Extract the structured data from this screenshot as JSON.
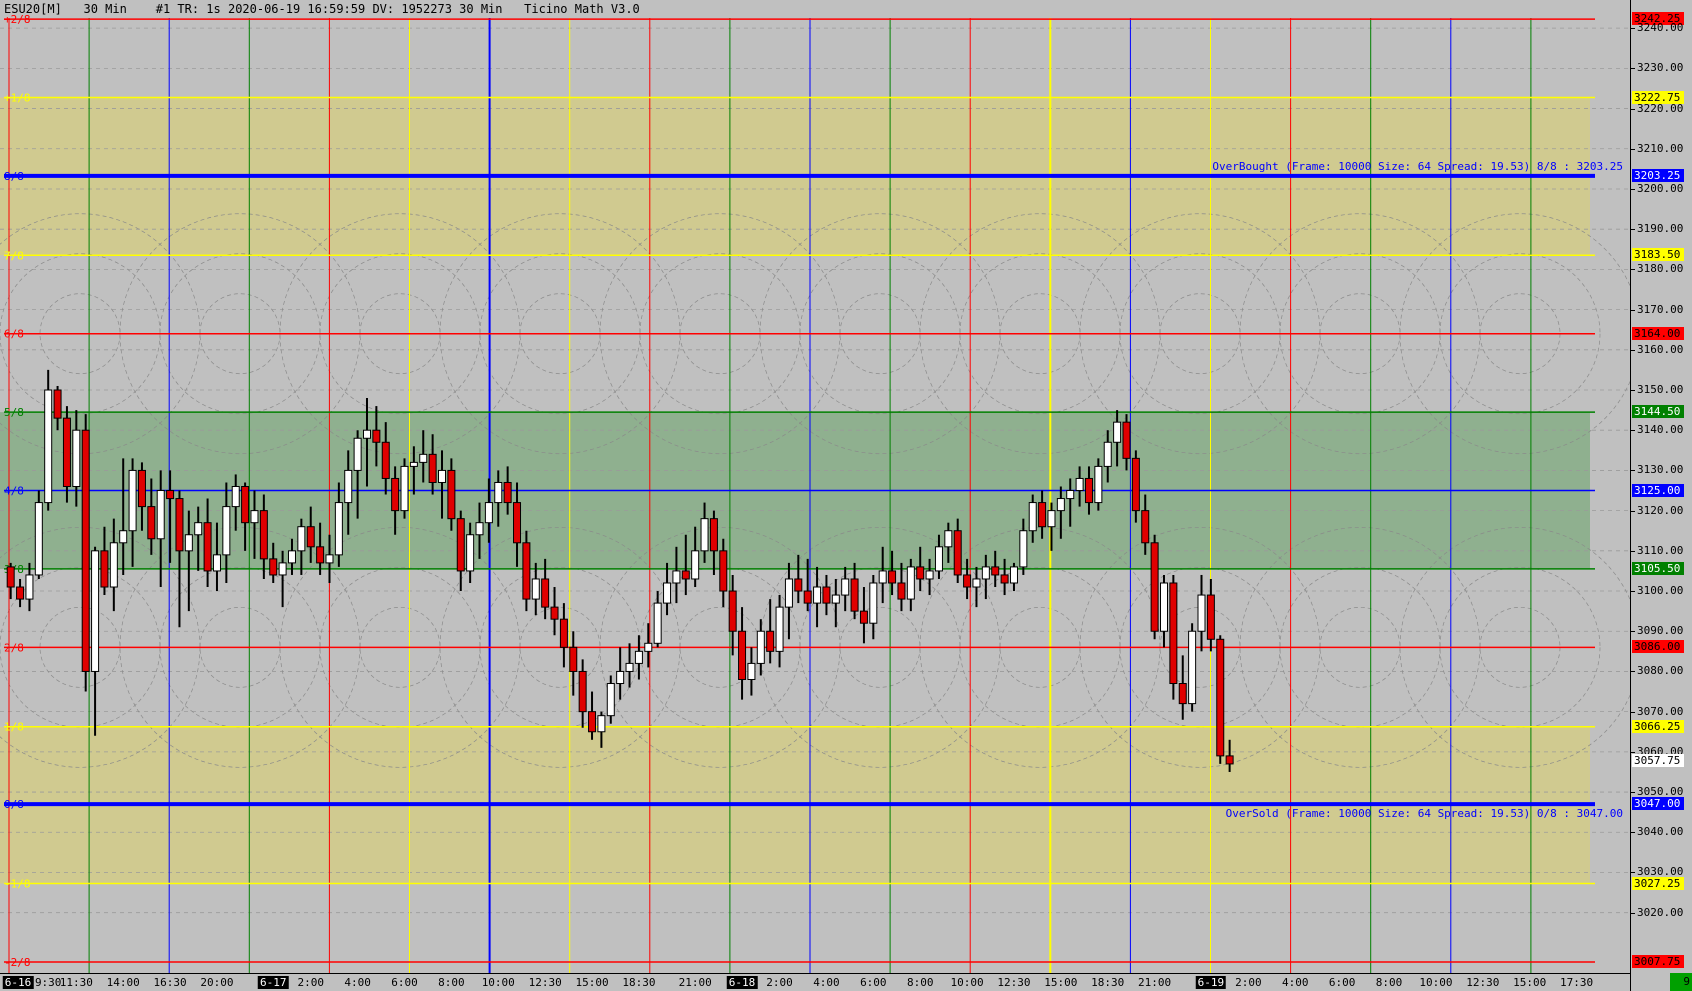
{
  "header": {
    "title": "ESU20[M]   30 Min    #1 TR: 1s 2020-06-19 16:59:59 DV: 1952273 30 Min   Ticino Math V3.0"
  },
  "colors": {
    "background": "#c0c0c0",
    "band_yellow": "#d0ca90",
    "band_green": "#8fb08f",
    "red": "#ff0000",
    "yellow": "#ffff00",
    "blue": "#0000ff",
    "green": "#008000",
    "candle_up": "#ffffff",
    "candle_down": "#e00000"
  },
  "chart_data": {
    "type": "candlestick",
    "symbol": "ESU20[M]",
    "timeframe": "30 Min",
    "ylim": [
      3005,
      3247
    ],
    "y_ticks": [
      3020,
      3030,
      3040,
      3050,
      3060,
      3070,
      3080,
      3090,
      3100,
      3110,
      3120,
      3130,
      3140,
      3150,
      3160,
      3170,
      3180,
      3190,
      3200,
      3210,
      3220,
      3230,
      3240
    ],
    "y_tick_labels": [
      "3020.00",
      "3030.00",
      "3040.00",
      "3050.00",
      "3060.00",
      "3070.00",
      "3080.00",
      "3090.00",
      "3100.00",
      "3110.00",
      "3120.00",
      "3130.00",
      "3140.00",
      "3150.00",
      "3160.00",
      "3170.00",
      "3180.00",
      "3190.00",
      "3200.00",
      "3210.00",
      "3220.00",
      "3230.00",
      "3240.00"
    ],
    "murrey_levels": [
      {
        "label": "+2/8",
        "price": 3242.25,
        "price_label": "3242.25",
        "color": "#ff0000",
        "width": 1.5
      },
      {
        "label": "+1/8",
        "price": 3222.75,
        "price_label": "3222.75",
        "color": "#ffff00",
        "width": 1.5
      },
      {
        "label": "8/8",
        "price": 3203.25,
        "price_label": "3203.25",
        "color": "#0000ff",
        "width": 4
      },
      {
        "label": "7/8",
        "price": 3183.5,
        "price_label": "3183.50",
        "color": "#ffff00",
        "width": 1.5
      },
      {
        "label": "6/8",
        "price": 3164.0,
        "price_label": "3164.00",
        "color": "#ff0000",
        "width": 1.5
      },
      {
        "label": "5/8",
        "price": 3144.5,
        "price_label": "3144.50",
        "color": "#008000",
        "width": 1.5
      },
      {
        "label": "4/8",
        "price": 3125.0,
        "price_label": "3125.00",
        "color": "#0000ff",
        "width": 1.5
      },
      {
        "label": "3/8",
        "price": 3105.5,
        "price_label": "3105.50",
        "color": "#008000",
        "width": 1.5
      },
      {
        "label": "2/8",
        "price": 3086.0,
        "price_label": "3086.00",
        "color": "#ff0000",
        "width": 1.5
      },
      {
        "label": "1/8",
        "price": 3066.25,
        "price_label": "3066.25",
        "color": "#ffff00",
        "width": 1.5
      },
      {
        "label": "0/8",
        "price": 3047.0,
        "price_label": "3047.00",
        "color": "#0000ff",
        "width": 4
      },
      {
        "label": "-1/8",
        "price": 3027.25,
        "price_label": "3027.25",
        "color": "#ffff00",
        "width": 1.5
      },
      {
        "label": "-2/8",
        "price": 3007.75,
        "price_label": "3007.75",
        "color": "#ff0000",
        "width": 1.5
      }
    ],
    "bands": [
      {
        "from": 3183.5,
        "to": 3222.75,
        "color": "#d0ca90"
      },
      {
        "from": 3105.5,
        "to": 3144.5,
        "color": "#8fb08f"
      },
      {
        "from": 3027.25,
        "to": 3066.25,
        "color": "#d0ca90"
      }
    ],
    "annotations": {
      "overbought": "OverBought (Frame: 10000 Size: 64 Spread: 19.53) 8/8 : 3203.25",
      "oversold": "OverSold (Frame: 10000 Size: 64 Spread: 19.53) 0/8 : 3047.00"
    },
    "last_price": "3057.75",
    "corner_value": "9",
    "x_labels": [
      {
        "bar": 0,
        "text": "6-16",
        "date": true
      },
      {
        "bar": 4,
        "text": "9:30"
      },
      {
        "bar": 7,
        "text": "11:30"
      },
      {
        "bar": 12,
        "text": "14:00"
      },
      {
        "bar": 17,
        "text": "16:30"
      },
      {
        "bar": 22,
        "text": "20:00"
      },
      {
        "bar": 28,
        "text": "6-17",
        "date": true
      },
      {
        "bar": 32,
        "text": "2:00"
      },
      {
        "bar": 37,
        "text": "4:00"
      },
      {
        "bar": 42,
        "text": "6:00"
      },
      {
        "bar": 47,
        "text": "8:00"
      },
      {
        "bar": 52,
        "text": "10:00"
      },
      {
        "bar": 57,
        "text": "12:30"
      },
      {
        "bar": 62,
        "text": "15:00"
      },
      {
        "bar": 67,
        "text": "18:30"
      },
      {
        "bar": 73,
        "text": "21:00"
      },
      {
        "bar": 78,
        "text": "6-18",
        "date": true
      },
      {
        "bar": 82,
        "text": "2:00"
      },
      {
        "bar": 87,
        "text": "4:00"
      },
      {
        "bar": 92,
        "text": "6:00"
      },
      {
        "bar": 97,
        "text": "8:00"
      },
      {
        "bar": 102,
        "text": "10:00"
      },
      {
        "bar": 107,
        "text": "12:30"
      },
      {
        "bar": 112,
        "text": "15:00"
      },
      {
        "bar": 117,
        "text": "18:30"
      },
      {
        "bar": 122,
        "text": "21:00"
      },
      {
        "bar": 128,
        "text": "6-19",
        "date": true
      },
      {
        "bar": 132,
        "text": "2:00"
      },
      {
        "bar": 137,
        "text": "4:00"
      },
      {
        "bar": 142,
        "text": "6:00"
      },
      {
        "bar": 147,
        "text": "8:00"
      },
      {
        "bar": 152,
        "text": "10:00"
      },
      {
        "bar": 157,
        "text": "12:30"
      },
      {
        "bar": 162,
        "text": "15:00"
      },
      {
        "bar": 167,
        "text": "17:30"
      }
    ],
    "candles": [
      [
        3106,
        3107,
        3098,
        3101
      ],
      [
        3101,
        3103,
        3096,
        3098
      ],
      [
        3098,
        3107,
        3095,
        3104
      ],
      [
        3104,
        3125,
        3103,
        3122
      ],
      [
        3122,
        3155,
        3120,
        3150
      ],
      [
        3150,
        3151,
        3140,
        3143
      ],
      [
        3143,
        3146,
        3122,
        3126
      ],
      [
        3126,
        3145,
        3121,
        3140
      ],
      [
        3140,
        3144,
        3075,
        3080
      ],
      [
        3080,
        3111,
        3064,
        3110
      ],
      [
        3110,
        3116,
        3099,
        3101
      ],
      [
        3101,
        3118,
        3095,
        3112
      ],
      [
        3112,
        3133,
        3104,
        3115
      ],
      [
        3115,
        3133,
        3106,
        3130
      ],
      [
        3130,
        3132,
        3115,
        3121
      ],
      [
        3121,
        3128,
        3109,
        3113
      ],
      [
        3113,
        3130,
        3101,
        3125
      ],
      [
        3125,
        3130,
        3107,
        3123
      ],
      [
        3123,
        3125,
        3091,
        3110
      ],
      [
        3110,
        3120,
        3095,
        3114
      ],
      [
        3114,
        3121,
        3105,
        3117
      ],
      [
        3117,
        3123,
        3101,
        3105
      ],
      [
        3105,
        3117,
        3100,
        3109
      ],
      [
        3109,
        3127,
        3102,
        3121
      ],
      [
        3121,
        3129,
        3115,
        3126
      ],
      [
        3126,
        3127,
        3110,
        3117
      ],
      [
        3117,
        3125,
        3108,
        3120
      ],
      [
        3120,
        3124,
        3103,
        3108
      ],
      [
        3108,
        3112,
        3102,
        3104
      ],
      [
        3104,
        3110,
        3096,
        3107
      ],
      [
        3107,
        3113,
        3104,
        3110
      ],
      [
        3110,
        3118,
        3104,
        3116
      ],
      [
        3116,
        3121,
        3107,
        3111
      ],
      [
        3111,
        3117,
        3104,
        3107
      ],
      [
        3107,
        3114,
        3102,
        3109
      ],
      [
        3109,
        3127,
        3106,
        3122
      ],
      [
        3122,
        3135,
        3114,
        3130
      ],
      [
        3130,
        3140,
        3118,
        3138
      ],
      [
        3138,
        3148,
        3126,
        3140
      ],
      [
        3140,
        3146,
        3131,
        3137
      ],
      [
        3137,
        3142,
        3124,
        3128
      ],
      [
        3128,
        3131,
        3114,
        3120
      ],
      [
        3120,
        3133,
        3118,
        3131
      ],
      [
        3131,
        3136,
        3124,
        3132
      ],
      [
        3132,
        3140,
        3127,
        3134
      ],
      [
        3134,
        3139,
        3124,
        3127
      ],
      [
        3127,
        3135,
        3118,
        3130
      ],
      [
        3130,
        3133,
        3115,
        3118
      ],
      [
        3118,
        3120,
        3100,
        3105
      ],
      [
        3105,
        3117,
        3102,
        3114
      ],
      [
        3114,
        3122,
        3108,
        3117
      ],
      [
        3117,
        3128,
        3112,
        3122
      ],
      [
        3122,
        3130,
        3116,
        3127
      ],
      [
        3127,
        3131,
        3119,
        3122
      ],
      [
        3122,
        3127,
        3106,
        3112
      ],
      [
        3112,
        3115,
        3095,
        3098
      ],
      [
        3098,
        3107,
        3094,
        3103
      ],
      [
        3103,
        3108,
        3093,
        3096
      ],
      [
        3096,
        3101,
        3089,
        3093
      ],
      [
        3093,
        3097,
        3081,
        3086
      ],
      [
        3086,
        3090,
        3074,
        3080
      ],
      [
        3080,
        3083,
        3066,
        3070
      ],
      [
        3070,
        3075,
        3063,
        3065
      ],
      [
        3065,
        3070,
        3061,
        3069
      ],
      [
        3069,
        3079,
        3067,
        3077
      ],
      [
        3077,
        3086,
        3073,
        3080
      ],
      [
        3080,
        3087,
        3076,
        3082
      ],
      [
        3082,
        3089,
        3078,
        3085
      ],
      [
        3085,
        3092,
        3081,
        3087
      ],
      [
        3087,
        3100,
        3086,
        3097
      ],
      [
        3097,
        3107,
        3094,
        3102
      ],
      [
        3102,
        3111,
        3097,
        3105
      ],
      [
        3105,
        3114,
        3099,
        3103
      ],
      [
        3103,
        3116,
        3101,
        3110
      ],
      [
        3110,
        3122,
        3107,
        3118
      ],
      [
        3118,
        3120,
        3104,
        3110
      ],
      [
        3110,
        3113,
        3096,
        3100
      ],
      [
        3100,
        3104,
        3084,
        3090
      ],
      [
        3090,
        3096,
        3073,
        3078
      ],
      [
        3078,
        3086,
        3074,
        3082
      ],
      [
        3082,
        3093,
        3079,
        3090
      ],
      [
        3090,
        3098,
        3082,
        3085
      ],
      [
        3085,
        3099,
        3081,
        3096
      ],
      [
        3096,
        3107,
        3088,
        3103
      ],
      [
        3103,
        3109,
        3097,
        3100
      ],
      [
        3100,
        3108,
        3095,
        3097
      ],
      [
        3097,
        3106,
        3091,
        3101
      ],
      [
        3101,
        3104,
        3094,
        3097
      ],
      [
        3097,
        3103,
        3091,
        3099
      ],
      [
        3099,
        3106,
        3095,
        3103
      ],
      [
        3103,
        3107,
        3093,
        3095
      ],
      [
        3095,
        3101,
        3087,
        3092
      ],
      [
        3092,
        3104,
        3088,
        3102
      ],
      [
        3102,
        3111,
        3097,
        3105
      ],
      [
        3105,
        3110,
        3099,
        3102
      ],
      [
        3102,
        3107,
        3095,
        3098
      ],
      [
        3098,
        3108,
        3095,
        3106
      ],
      [
        3106,
        3111,
        3100,
        3103
      ],
      [
        3103,
        3108,
        3099,
        3105
      ],
      [
        3105,
        3114,
        3103,
        3111
      ],
      [
        3111,
        3117,
        3107,
        3115
      ],
      [
        3115,
        3118,
        3102,
        3104
      ],
      [
        3104,
        3108,
        3098,
        3101
      ],
      [
        3101,
        3106,
        3096,
        3103
      ],
      [
        3103,
        3109,
        3098,
        3106
      ],
      [
        3106,
        3110,
        3101,
        3104
      ],
      [
        3104,
        3108,
        3099,
        3102
      ],
      [
        3102,
        3107,
        3100,
        3106
      ],
      [
        3106,
        3118,
        3104,
        3115
      ],
      [
        3115,
        3124,
        3112,
        3122
      ],
      [
        3122,
        3125,
        3113,
        3116
      ],
      [
        3116,
        3122,
        3110,
        3120
      ],
      [
        3120,
        3126,
        3113,
        3123
      ],
      [
        3123,
        3128,
        3116,
        3125
      ],
      [
        3125,
        3131,
        3121,
        3128
      ],
      [
        3128,
        3131,
        3119,
        3122
      ],
      [
        3122,
        3133,
        3120,
        3131
      ],
      [
        3131,
        3140,
        3127,
        3137
      ],
      [
        3137,
        3145,
        3131,
        3142
      ],
      [
        3142,
        3144,
        3130,
        3133
      ],
      [
        3133,
        3135,
        3117,
        3120
      ],
      [
        3120,
        3124,
        3109,
        3112
      ],
      [
        3112,
        3114,
        3088,
        3090
      ],
      [
        3090,
        3104,
        3086,
        3102
      ],
      [
        3102,
        3104,
        3073,
        3077
      ],
      [
        3077,
        3084,
        3068,
        3072
      ],
      [
        3072,
        3092,
        3070,
        3090
      ],
      [
        3090,
        3104,
        3085,
        3099
      ],
      [
        3099,
        3103,
        3085,
        3088
      ],
      [
        3088,
        3089,
        3057,
        3059
      ],
      [
        3059,
        3063,
        3055,
        3057
      ]
    ]
  }
}
